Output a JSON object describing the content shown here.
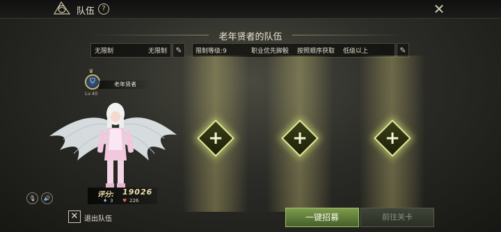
{
  "header": {
    "title": "队伍",
    "help_symbol": "?",
    "close_symbol": "✕",
    "logo_icon": "dragon-emblem-icon"
  },
  "team": {
    "name": "老年贤者的队伍"
  },
  "filters": {
    "field1_left": "无限制",
    "field1_right": "无限制",
    "field2_items": [
      "限制等级:9",
      "职业优先脚骰",
      "按照顺序获取",
      "低级以上"
    ]
  },
  "character": {
    "level": "Lv.40",
    "name": "老年贤者",
    "score_label": "评分:",
    "score": "19026",
    "stat1": "3",
    "stat2": "226"
  },
  "slots": [
    {
      "label": "+"
    },
    {
      "label": "+"
    },
    {
      "label": "+"
    }
  ],
  "footer": {
    "exit_label": "退出队伍",
    "recruit_label": "一键招募",
    "goto_label": "前往关卡"
  },
  "colors": {
    "accent_green": "#6f8c45",
    "slot_glow": "#dfe89a",
    "gold": "#d8c06a"
  }
}
